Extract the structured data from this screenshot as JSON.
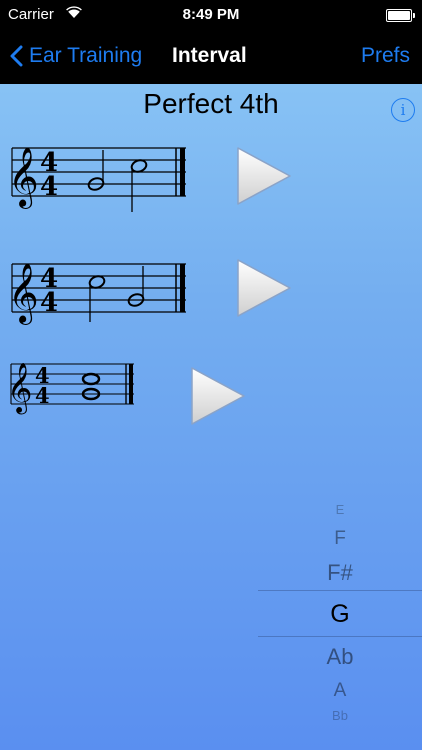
{
  "status_bar": {
    "carrier": "Carrier",
    "time": "8:49 PM"
  },
  "nav": {
    "back_label": "Ear Training",
    "title": "Interval",
    "prefs_label": "Prefs"
  },
  "interval_name": "Perfect 4th",
  "info_glyph": "i",
  "time_signature": {
    "top": "4",
    "bottom": "4"
  },
  "examples": [
    {
      "mode": "ascending"
    },
    {
      "mode": "descending"
    },
    {
      "mode": "harmonic"
    }
  ],
  "key_picker": {
    "options": [
      "E",
      "F",
      "F#",
      "G",
      "Ab",
      "A",
      "Bb"
    ],
    "selected": "G"
  },
  "colors": {
    "accent": "#1e7cf0",
    "bg_top": "#8fcaf6",
    "bg_bottom": "#5a8ff0"
  }
}
